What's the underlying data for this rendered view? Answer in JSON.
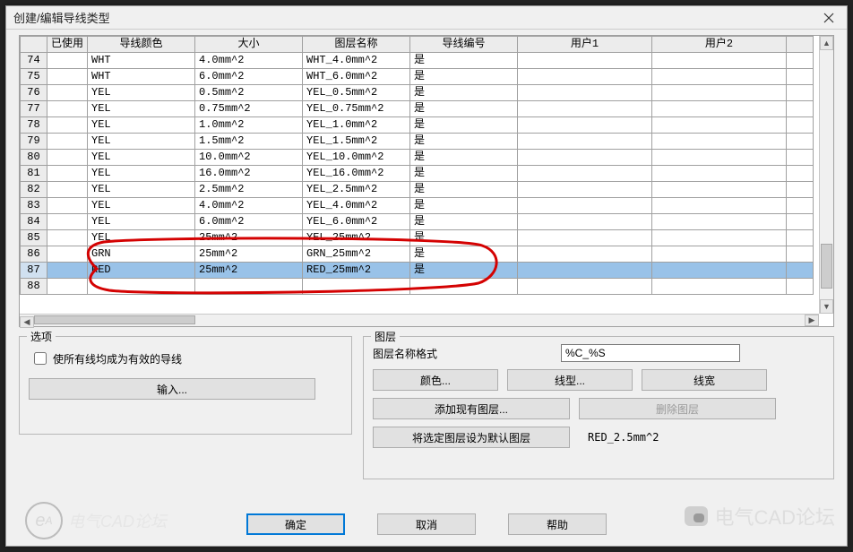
{
  "window": {
    "title": "创建/编辑导线类型"
  },
  "grid": {
    "headers": {
      "rownum": "",
      "used": "已使用",
      "color": "导线颜色",
      "size": "大小",
      "layer": "图层名称",
      "number": "导线编号",
      "user1": "用户1",
      "user2": "用户2"
    },
    "rows": [
      {
        "n": "74",
        "used": "",
        "color": "WHT",
        "size": "4.0mm^2",
        "layer": "WHT_4.0mm^2",
        "number": "是",
        "u1": "",
        "u2": ""
      },
      {
        "n": "75",
        "used": "",
        "color": "WHT",
        "size": "6.0mm^2",
        "layer": "WHT_6.0mm^2",
        "number": "是",
        "u1": "",
        "u2": ""
      },
      {
        "n": "76",
        "used": "",
        "color": "YEL",
        "size": "0.5mm^2",
        "layer": "YEL_0.5mm^2",
        "number": "是",
        "u1": "",
        "u2": ""
      },
      {
        "n": "77",
        "used": "",
        "color": "YEL",
        "size": "0.75mm^2",
        "layer": "YEL_0.75mm^2",
        "number": "是",
        "u1": "",
        "u2": ""
      },
      {
        "n": "78",
        "used": "",
        "color": "YEL",
        "size": "1.0mm^2",
        "layer": "YEL_1.0mm^2",
        "number": "是",
        "u1": "",
        "u2": ""
      },
      {
        "n": "79",
        "used": "",
        "color": "YEL",
        "size": "1.5mm^2",
        "layer": "YEL_1.5mm^2",
        "number": "是",
        "u1": "",
        "u2": ""
      },
      {
        "n": "80",
        "used": "",
        "color": "YEL",
        "size": "10.0mm^2",
        "layer": "YEL_10.0mm^2",
        "number": "是",
        "u1": "",
        "u2": ""
      },
      {
        "n": "81",
        "used": "",
        "color": "YEL",
        "size": "16.0mm^2",
        "layer": "YEL_16.0mm^2",
        "number": "是",
        "u1": "",
        "u2": ""
      },
      {
        "n": "82",
        "used": "",
        "color": "YEL",
        "size": "2.5mm^2",
        "layer": "YEL_2.5mm^2",
        "number": "是",
        "u1": "",
        "u2": ""
      },
      {
        "n": "83",
        "used": "",
        "color": "YEL",
        "size": "4.0mm^2",
        "layer": "YEL_4.0mm^2",
        "number": "是",
        "u1": "",
        "u2": ""
      },
      {
        "n": "84",
        "used": "",
        "color": "YEL",
        "size": "6.0mm^2",
        "layer": "YEL_6.0mm^2",
        "number": "是",
        "u1": "",
        "u2": ""
      },
      {
        "n": "85",
        "used": "",
        "color": "YEL",
        "size": "25mm^2",
        "layer": "YEL_25mm^2",
        "number": "是",
        "u1": "",
        "u2": ""
      },
      {
        "n": "86",
        "used": "",
        "color": "GRN",
        "size": "25mm^2",
        "layer": "GRN_25mm^2",
        "number": "是",
        "u1": "",
        "u2": ""
      },
      {
        "n": "87",
        "used": "",
        "color": "RED",
        "size": "25mm^2",
        "layer": "RED_25mm^2",
        "number": "是",
        "u1": "",
        "u2": "",
        "selected": true
      },
      {
        "n": "88",
        "used": "",
        "color": "",
        "size": "",
        "layer": "",
        "number": "",
        "u1": "",
        "u2": ""
      }
    ]
  },
  "options": {
    "group_label": "选项",
    "checkbox_label": "使所有线均成为有效的导线",
    "import_btn": "输入..."
  },
  "layer": {
    "group_label": "图层",
    "format_label": "图层名称格式",
    "format_value": "%C_%S",
    "color_btn": "颜色...",
    "linetype_btn": "线型...",
    "lineweight_btn": "线宽",
    "add_btn": "添加现有图层...",
    "delete_btn": "删除图层",
    "default_btn": "将选定图层设为默认图层",
    "default_value": "RED_2.5mm^2"
  },
  "footer": {
    "ok": "确定",
    "cancel": "取消",
    "help": "帮助"
  },
  "watermark": {
    "left": "电气CAD论坛",
    "right": "电气CAD论坛"
  }
}
